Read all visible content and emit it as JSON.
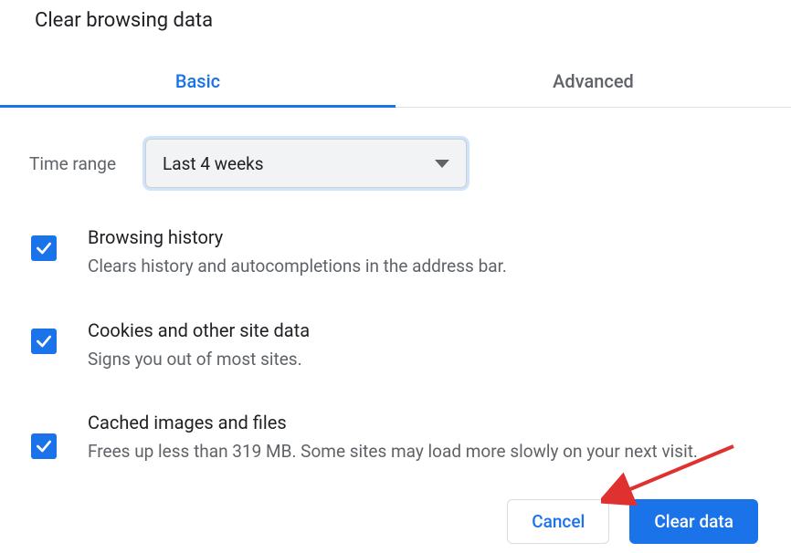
{
  "dialog": {
    "title": "Clear browsing data"
  },
  "tabs": {
    "basic": "Basic",
    "advanced": "Advanced",
    "active": "basic"
  },
  "timeRange": {
    "label": "Time range",
    "value": "Last 4 weeks"
  },
  "options": [
    {
      "id": "browsing-history",
      "title": "Browsing history",
      "desc": "Clears history and autocompletions in the address bar.",
      "checked": true
    },
    {
      "id": "cookies",
      "title": "Cookies and other site data",
      "desc": "Signs you out of most sites.",
      "checked": true
    },
    {
      "id": "cache",
      "title": "Cached images and files",
      "desc": "Frees up less than 319 MB. Some sites may load more slowly on your next visit.",
      "checked": true
    }
  ],
  "buttons": {
    "cancel": "Cancel",
    "clear": "Clear data"
  },
  "colors": {
    "accent": "#1a73e8",
    "text": "#202124",
    "muted": "#5f6368"
  }
}
